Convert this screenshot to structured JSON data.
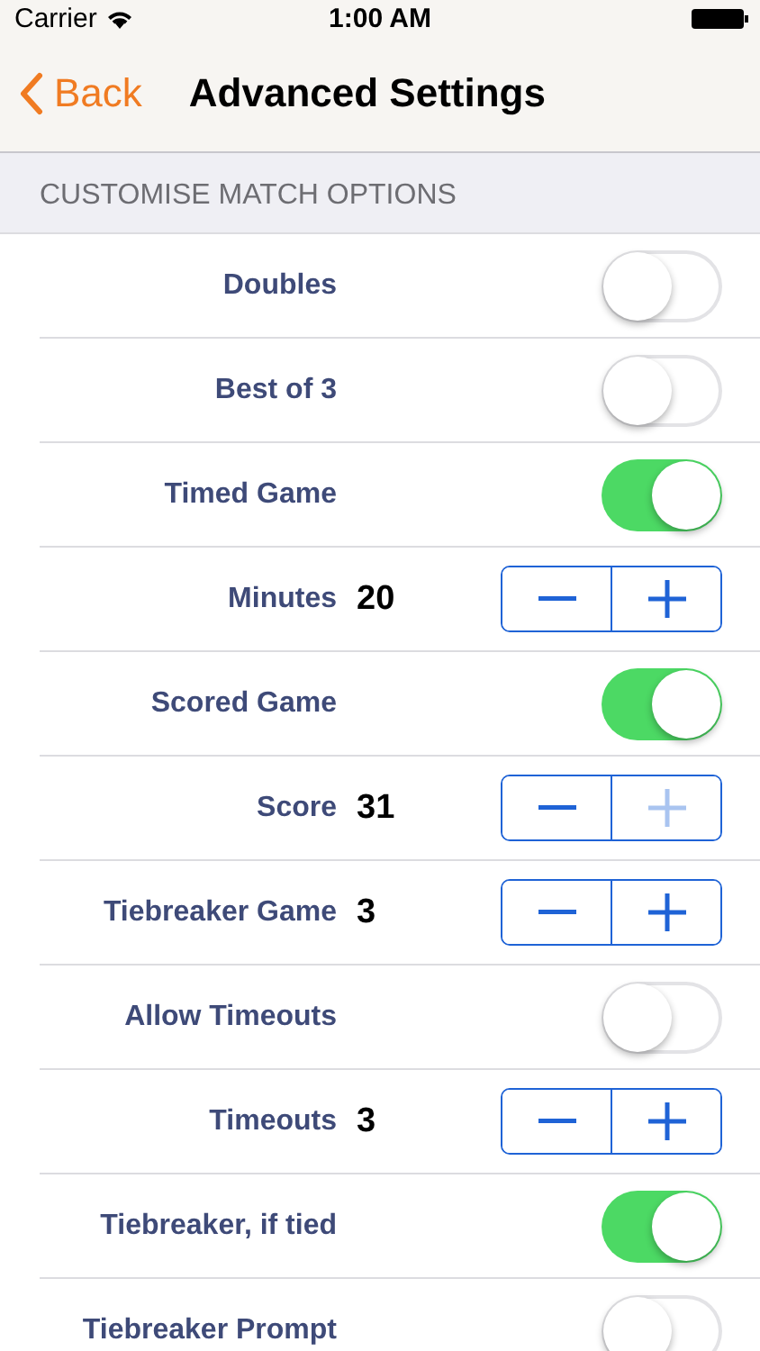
{
  "status_bar": {
    "carrier": "Carrier",
    "time": "1:00 AM"
  },
  "nav": {
    "back": "Back",
    "title": "Advanced Settings"
  },
  "section": {
    "header": "CUSTOMISE MATCH OPTIONS",
    "rows": [
      {
        "kind": "toggle",
        "label": "Doubles",
        "on": false
      },
      {
        "kind": "toggle",
        "label": "Best of 3",
        "on": false
      },
      {
        "kind": "toggle",
        "label": "Timed Game",
        "on": true
      },
      {
        "kind": "stepper",
        "label": "Minutes",
        "value": "20",
        "minus_disabled": false,
        "plus_disabled": false
      },
      {
        "kind": "toggle",
        "label": "Scored Game",
        "on": true
      },
      {
        "kind": "stepper",
        "label": "Score",
        "value": "31",
        "minus_disabled": false,
        "plus_disabled": true
      },
      {
        "kind": "stepper",
        "label": "Tiebreaker Game",
        "value": "3",
        "minus_disabled": false,
        "plus_disabled": false
      },
      {
        "kind": "toggle",
        "label": "Allow Timeouts",
        "on": false
      },
      {
        "kind": "stepper",
        "label": "Timeouts",
        "value": "3",
        "minus_disabled": false,
        "plus_disabled": false
      },
      {
        "kind": "toggle",
        "label": "Tiebreaker, if tied",
        "on": true
      },
      {
        "kind": "toggle",
        "label": "Tiebreaker Prompt",
        "on": false
      }
    ]
  }
}
